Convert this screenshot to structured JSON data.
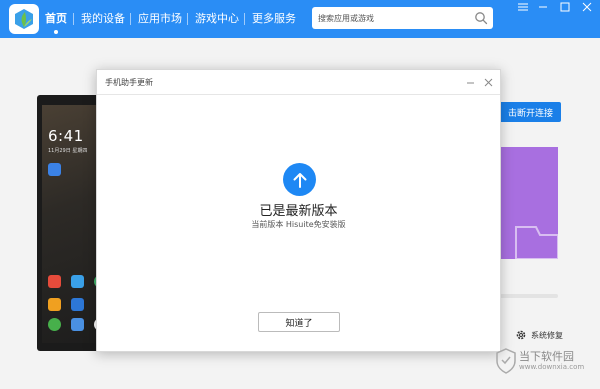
{
  "nav": {
    "items": [
      {
        "label": "首页",
        "active": true
      },
      {
        "label": "我的设备",
        "active": false
      },
      {
        "label": "应用市场",
        "active": false
      },
      {
        "label": "游戏中心",
        "active": false
      },
      {
        "label": "更多服务",
        "active": false
      }
    ]
  },
  "search": {
    "placeholder": "搜索应用或游戏",
    "value": ""
  },
  "window_controls": [
    "menu-icon",
    "minimize-icon",
    "maximize-icon",
    "close-icon"
  ],
  "phone": {
    "time": "6:41",
    "date": "11月29日 星期四"
  },
  "connect_button": {
    "label": "点击断开连接",
    "visible_label": "击断开连接"
  },
  "system_repair": {
    "label": "系统修复"
  },
  "dialog": {
    "title": "手机助手更新",
    "heading": "已是最新版本",
    "subtext": "当前版本 Hisuite免安装版",
    "ok_label": "知道了"
  },
  "watermark": {
    "text": "当下软件园",
    "url": "www.downxia.com"
  },
  "colors": {
    "topbar": "#2a8df5",
    "accent": "#1e88f4",
    "promo": "#a86fe0"
  }
}
